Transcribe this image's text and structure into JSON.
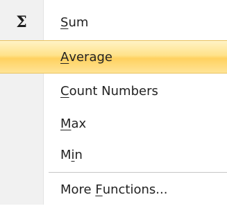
{
  "menu": {
    "items": [
      {
        "label": "Sum",
        "mnemonic_index": 0,
        "icon": "sigma-icon",
        "icon_glyph": "Σ",
        "highlighted": false
      },
      {
        "label": "Average",
        "mnemonic_index": 0,
        "highlighted": true
      },
      {
        "label": "Count Numbers",
        "mnemonic_index": 0,
        "highlighted": false
      },
      {
        "label": "Max",
        "mnemonic_index": 0,
        "highlighted": false
      },
      {
        "label": "Min",
        "mnemonic_index": 1,
        "highlighted": false
      },
      {
        "label": "More Functions...",
        "mnemonic_index": 5,
        "highlighted": false
      }
    ]
  },
  "colors": {
    "gutter": "#f1f1f1",
    "highlight": "#ffdf7d",
    "highlight_border": "#e9c25f",
    "separator": "#c5c5c5"
  }
}
